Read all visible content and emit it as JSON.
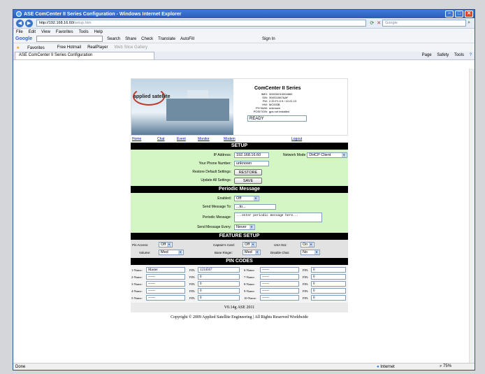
{
  "window": {
    "title": "ASE ComCenter II Series Configuration - Windows Internet Explorer"
  },
  "address": {
    "url_host": "http://192.168.16.60/",
    "url_path": "setup.htm",
    "search_placeholder": "Google"
  },
  "menu": [
    "File",
    "Edit",
    "View",
    "Favorites",
    "Tools",
    "Help"
  ],
  "google_toolbar": {
    "label": "Google",
    "items": [
      "Search",
      "Share",
      "Check",
      "Translate",
      "AutoFill",
      "Sign In"
    ]
  },
  "favorites": {
    "label": "Favorites",
    "items": [
      "Free Hotmail",
      "RealPlayer",
      "Web Slice Gallery"
    ]
  },
  "tab": {
    "label": "ASE ComCenter II Series Configuration",
    "tools": [
      "Page",
      "Safety",
      "Tools"
    ]
  },
  "status": {
    "left": "Done",
    "zone": "Internet",
    "zoom": "75%"
  },
  "device": {
    "logo": "applied satellite",
    "title": "ComCenter II Series",
    "info": [
      {
        "k": "IMEI:",
        "v": "300034010004660"
      },
      {
        "k": "S/N:",
        "v": "300011567AAF"
      },
      {
        "k": "FW:",
        "v": "2.20.F1.0.9 / 10.01.13"
      },
      {
        "k": "HW:",
        "v": "MC003B"
      },
      {
        "k": "PH NUM:",
        "v": "unknown"
      },
      {
        "k": "POSITION:",
        "v": "gps not installed"
      }
    ],
    "status": "READY"
  },
  "nav": [
    "Home",
    "Chat",
    "Event",
    "Monitor",
    "Modem",
    "Logout"
  ],
  "setup": {
    "title": "SETUP",
    "ip_label": "IP Address:",
    "ip_value": "192.168.16.60",
    "netmode_label": "Network Mode",
    "netmode_value": "DHCP Client",
    "phone_label": "Your Phone Number:",
    "phone_value": "unknown",
    "restore_label": "Restore Default Settings:",
    "restore_btn": "RESTORE",
    "update_label": "Update All Settings:",
    "update_btn": "SAVE"
  },
  "periodic": {
    "title": "Periodic Message",
    "enabled_label": "Enabled:",
    "enabled_value": "Off",
    "sendto_label": "Send Message To:",
    "sendto_value": "...to...",
    "msg_label": "Periodic Message:",
    "msg_value": "...enter periodic message here...",
    "every_label": "Send Message Every:",
    "every_value": "Never"
  },
  "feature": {
    "title": "FEATURE SETUP",
    "pin_access_label": "Pin Access:",
    "pin_access": "Off",
    "captains_card_label": "Captain's Card:",
    "captains_card": "Off",
    "usa911_label": "USA 911:",
    "usa911": "On",
    "volume_label": "Volume:",
    "volume": "Med",
    "base_ringer_label": "Base Ringer:",
    "base_ringer": "Med",
    "disable_chat_label": "Disable Chat:",
    "disable_chat": "No"
  },
  "pins": {
    "title": "PIN CODES",
    "pin_label": "PIN:",
    "rows": [
      {
        "l": {
          "label": "1-Name:",
          "name": "Master",
          "pin": "1234567"
        },
        "r": {
          "label": "6-Name:",
          "name": "------",
          "pin": "0"
        }
      },
      {
        "l": {
          "label": "2-Name:",
          "name": "------",
          "pin": "0"
        },
        "r": {
          "label": "7-Name:",
          "name": "------",
          "pin": "0"
        }
      },
      {
        "l": {
          "label": "3-Name:",
          "name": "------",
          "pin": "0"
        },
        "r": {
          "label": "8-Name:",
          "name": "------",
          "pin": "0"
        }
      },
      {
        "l": {
          "label": "4-Name:",
          "name": "------",
          "pin": "0"
        },
        "r": {
          "label": "9-Name:",
          "name": "------",
          "pin": "0"
        }
      },
      {
        "l": {
          "label": "5-Name:",
          "name": "------",
          "pin": "0"
        },
        "r": {
          "label": "10-Name:",
          "name": "------",
          "pin": "0"
        }
      }
    ]
  },
  "footer": {
    "version": "V0.14g ASE 2011",
    "copyright": "Copyright © 2009 Applied Satellite Engineering | All Rights Reserved Worldwide"
  }
}
